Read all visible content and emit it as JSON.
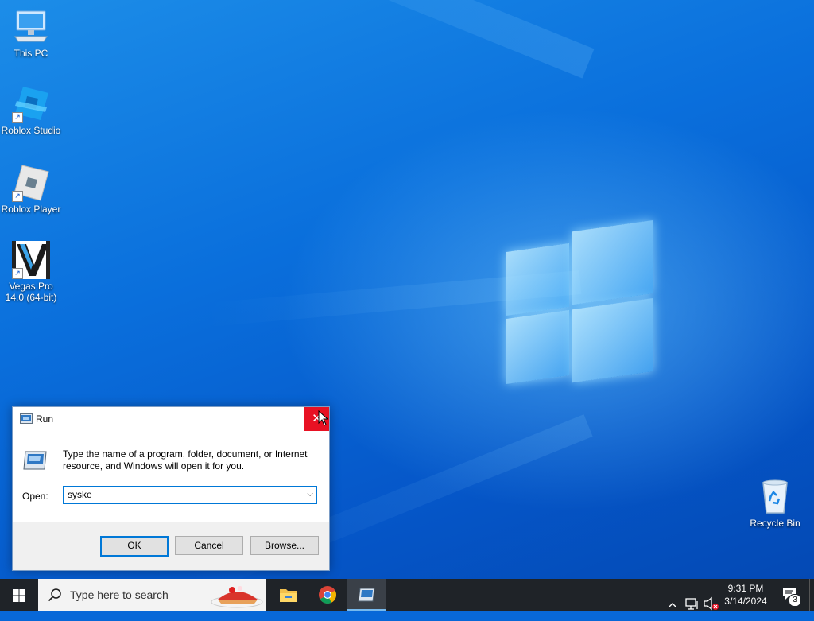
{
  "desktop": {
    "icons": [
      {
        "label": "This PC",
        "icon": "computer-icon"
      },
      {
        "label": "Roblox Studio",
        "icon": "roblox-studio-icon"
      },
      {
        "label": "Roblox Player",
        "icon": "roblox-player-icon"
      },
      {
        "label_line1": "Vegas Pro",
        "label_line2": "14.0 (64-bit)",
        "icon": "vegas-pro-icon"
      },
      {
        "label": "Recycle Bin",
        "icon": "recycle-bin-icon"
      }
    ]
  },
  "run_dialog": {
    "title": "Run",
    "close_glyph": "✕",
    "description": "Type the name of a program, folder, document, or Internet resource, and Windows will open it for you.",
    "open_label": "Open:",
    "open_value": "syske",
    "ok_label": "OK",
    "cancel_label": "Cancel",
    "browse_label": "Browse..."
  },
  "taskbar": {
    "search_placeholder": "Type here to search",
    "clock_time": "9:31 PM",
    "clock_date": "3/14/2024",
    "notification_count": "3",
    "pinned": [
      "file-explorer-icon",
      "chrome-icon",
      "run-icon"
    ]
  },
  "colors": {
    "accent": "#0078d7",
    "close_red": "#e81123",
    "taskbar": "#1f2328"
  }
}
